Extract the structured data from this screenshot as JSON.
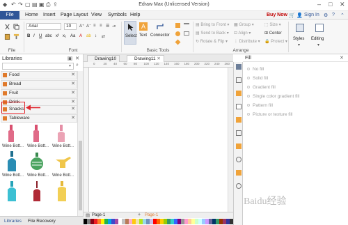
{
  "window": {
    "title": "Edraw Max (Unlicensed Version)"
  },
  "menu": {
    "file": "File",
    "items": [
      "Home",
      "Insert",
      "Page Layout",
      "View",
      "Symbols",
      "Help"
    ],
    "buy_now": "Buy Now",
    "sign_in": "Sign In"
  },
  "ribbon": {
    "file_group_label": "File",
    "font_group_label": "Font",
    "font_name": "Arial",
    "font_size": "10",
    "basic_tools_label": "Basic Tools",
    "select": "Select",
    "text": "Text",
    "connector": "Connector",
    "arrange_label": "Arrange",
    "bring_to_front": "Bring to Front",
    "send_to_back": "Send to Back",
    "rotate_flip": "Rotate & Flip",
    "group": "Group",
    "align": "Align",
    "distribute": "Distribute",
    "size": "Size",
    "center": "Center",
    "protect": "Protect",
    "styles": "Styles",
    "editing": "Editing"
  },
  "libraries": {
    "title": "Libraries",
    "categories": [
      "Food",
      "Bread",
      "Fruit",
      "Drink",
      "Snacks",
      "Tableware"
    ],
    "shape_labels": [
      "Wine Bott...",
      "Wine Bott...",
      "Wine Bott...",
      "Wine Bott...",
      "Wine Bott...",
      "Wine Bott..."
    ],
    "tabs": [
      "Libraries",
      "File Recovery"
    ]
  },
  "documents": {
    "tabs": [
      "Drawing10",
      "Drawing11"
    ],
    "page_tab": "Page-1",
    "page_tab_active": "Page-1",
    "ruler_ticks": [
      "0",
      "20",
      "40",
      "60",
      "80",
      "100",
      "120",
      "140",
      "160",
      "180",
      "200",
      "220",
      "240",
      "260"
    ]
  },
  "fill": {
    "title": "Fill",
    "options": [
      "No fill",
      "Solid fill",
      "Gradient fill",
      "Single color gradient fill",
      "Pattern fill",
      "Picture or texture fill"
    ]
  },
  "colors": {
    "accent": "#2f5597",
    "highlight": "#e0262e",
    "category_icon": "#e07a2b",
    "palette": [
      "#000000",
      "#7f7f7f",
      "#880015",
      "#ed1c24",
      "#ff7f27",
      "#fff200",
      "#22b14c",
      "#00a2e8",
      "#3f48cc",
      "#a349a4",
      "#ffffff",
      "#c3c3c3",
      "#b97a57",
      "#ffaec9",
      "#ffc90e",
      "#efe4b0",
      "#b5e61d",
      "#99d9ea",
      "#7092be",
      "#c8bfe7",
      "#ff0000",
      "#ff6600",
      "#ffcc00",
      "#99cc00",
      "#339966",
      "#33cccc",
      "#3366ff",
      "#800080",
      "#969696",
      "#ff99cc",
      "#ffcc99",
      "#ffff99",
      "#ccffcc",
      "#ccffff",
      "#99ccff",
      "#cc99ff",
      "#666699",
      "#003366",
      "#339966",
      "#993300",
      "#993366",
      "#333399",
      "#333333"
    ]
  },
  "watermark": "Baidu经验"
}
